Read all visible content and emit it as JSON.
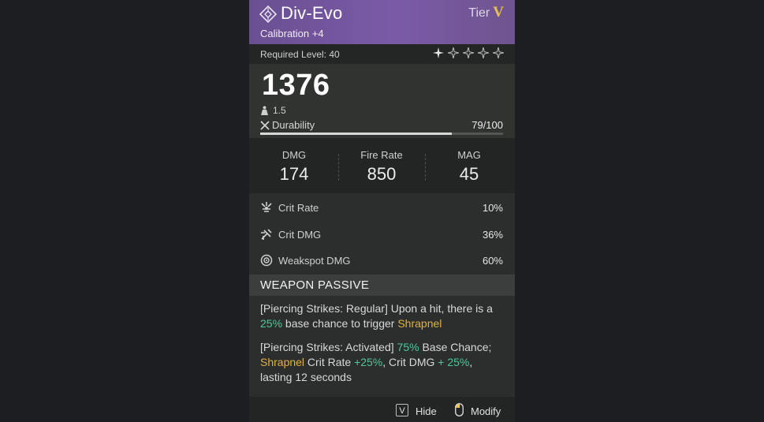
{
  "item": {
    "name": "Div-Evo",
    "tier_label": "Tier",
    "tier_value": "V",
    "calibration": "Calibration +4",
    "required_level": "Required Level: 40",
    "star_count": 5,
    "power": "1376",
    "weight": "1.5",
    "durability_label": "Durability",
    "durability_value": "79/100",
    "durability_fraction": 0.79
  },
  "primary_stats": [
    {
      "label": "DMG",
      "value": "174"
    },
    {
      "label": "Fire Rate",
      "value": "850"
    },
    {
      "label": "MAG",
      "value": "45"
    }
  ],
  "secondary_stats": [
    {
      "label": "Crit Rate",
      "value": "10%",
      "icon": "crit-rate-icon"
    },
    {
      "label": "Crit DMG",
      "value": "36%",
      "icon": "crit-dmg-icon"
    },
    {
      "label": "Weakspot DMG",
      "value": "60%",
      "icon": "weakspot-icon"
    }
  ],
  "passive": {
    "heading": "WEAPON PASSIVE",
    "p1": {
      "name": "[Piercing Strikes: Regular]",
      "t1": " Upon a hit, there is a ",
      "pct": "25%",
      "t2": " base chance to trigger ",
      "kw": "Shrapnel"
    },
    "p2": {
      "name": "[Piercing Strikes: Activated]",
      "pct1": " 75%",
      "t1": " Base Chance; ",
      "kw": "Shrapnel",
      "t2": " Crit Rate ",
      "pct2": "+25%",
      "t3": ", Crit DMG ",
      "pct3": "+ 25%",
      "t4": ", lasting 12 seconds"
    }
  },
  "footer": {
    "hide_key": "V",
    "hide_label": "Hide",
    "modify_label": "Modify"
  },
  "colors": {
    "header_purple": "#7a5aa6",
    "tier_gold": "#e8c24a",
    "highlight_green": "#4fc79a",
    "highlight_yellow": "#e0b23c"
  }
}
